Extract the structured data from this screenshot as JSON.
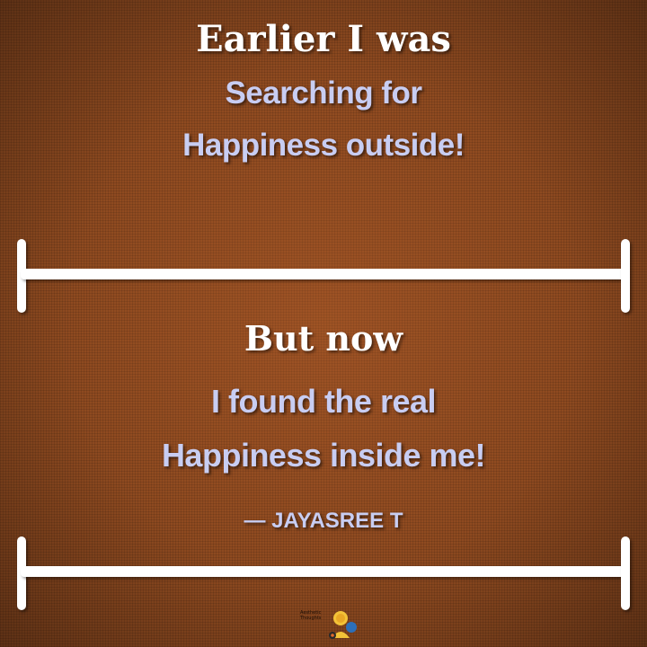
{
  "top_section": {
    "heading": "Earlier I was",
    "line1": "Searching for",
    "line2": "Happiness outside!"
  },
  "bottom_section": {
    "heading": "But now",
    "line1": "I found the real",
    "line2": "Happiness inside me!",
    "author": "— JAYASREE T"
  },
  "logo": {
    "line1": "Aesthetic",
    "line2": "Thoughts",
    "icon": "meditating-figure-icon"
  },
  "colors": {
    "background": "#8e4a20",
    "heading": "#ffffff",
    "subtext": "#c8cdf2",
    "divider": "#ffffff"
  }
}
